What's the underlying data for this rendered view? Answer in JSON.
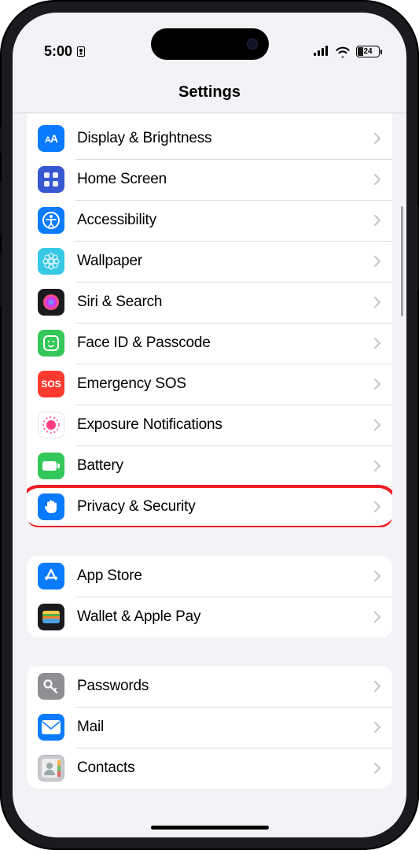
{
  "status": {
    "time": "5:00",
    "battery_pct": "24"
  },
  "header": {
    "title": "Settings"
  },
  "groups": [
    {
      "id": "general",
      "partial_top": true,
      "items": [
        {
          "id": "display",
          "label": "Display & Brightness",
          "icon_bg": "#0a7bff",
          "glyph": "AA"
        },
        {
          "id": "home",
          "label": "Home Screen",
          "icon_bg": "#3758d1",
          "glyph": "grid"
        },
        {
          "id": "accessibility",
          "label": "Accessibility",
          "icon_bg": "#0a7bff",
          "glyph": "access"
        },
        {
          "id": "wallpaper",
          "label": "Wallpaper",
          "icon_bg": "#37c8e6",
          "glyph": "flower"
        },
        {
          "id": "siri",
          "label": "Siri & Search",
          "icon_bg": "#1b1b1f",
          "glyph": "siri"
        },
        {
          "id": "faceid",
          "label": "Face ID & Passcode",
          "icon_bg": "#34c759",
          "glyph": "face"
        },
        {
          "id": "sos",
          "label": "Emergency SOS",
          "icon_bg": "#ff3b30",
          "glyph": "SOS"
        },
        {
          "id": "exposure",
          "label": "Exposure Notifications",
          "icon_bg": "#ffffff",
          "glyph": "exposure"
        },
        {
          "id": "battery",
          "label": "Battery",
          "icon_bg": "#34c759",
          "glyph": "battery"
        },
        {
          "id": "privacy",
          "label": "Privacy & Security",
          "icon_bg": "#0a7bff",
          "glyph": "hand",
          "highlighted": true
        }
      ]
    },
    {
      "id": "store",
      "items": [
        {
          "id": "appstore",
          "label": "App Store",
          "icon_bg": "#0a7bff",
          "glyph": "appstore"
        },
        {
          "id": "wallet",
          "label": "Wallet & Apple Pay",
          "icon_bg": "#1b1b1f",
          "glyph": "wallet"
        }
      ]
    },
    {
      "id": "apps",
      "items": [
        {
          "id": "passwords",
          "label": "Passwords",
          "icon_bg": "#8e8e93",
          "glyph": "key"
        },
        {
          "id": "mail",
          "label": "Mail",
          "icon_bg": "#0a7bff",
          "glyph": "mail"
        },
        {
          "id": "contacts",
          "label": "Contacts",
          "icon_bg": "#c9c9ce",
          "glyph": "contacts"
        }
      ]
    }
  ]
}
